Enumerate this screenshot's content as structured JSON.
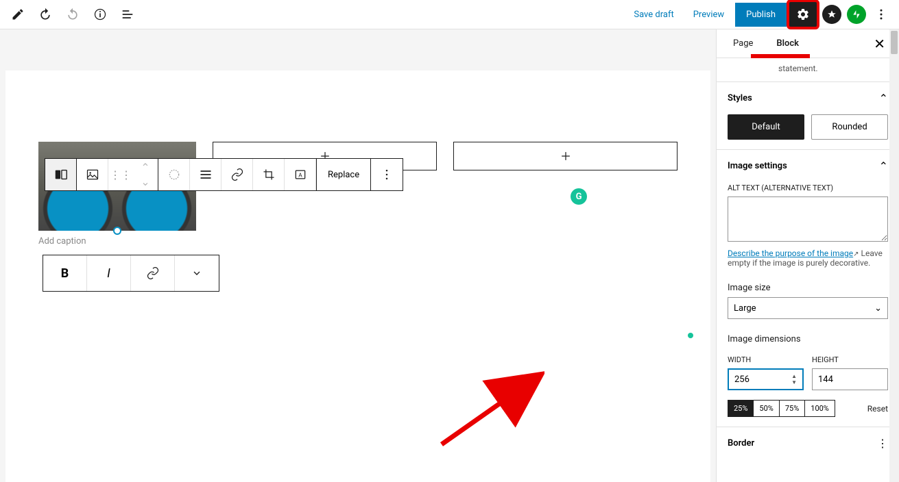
{
  "header": {
    "save_draft": "Save draft",
    "preview": "Preview",
    "publish": "Publish"
  },
  "toolbar": {
    "replace": "Replace"
  },
  "caption_placeholder": "Add caption",
  "sidebar": {
    "tabs": {
      "page": "Page",
      "block": "Block"
    },
    "statement": "statement.",
    "styles": {
      "title": "Styles",
      "default": "Default",
      "rounded": "Rounded"
    },
    "image_settings": {
      "title": "Image settings",
      "alt_label": "ALT TEXT (ALTERNATIVE TEXT)",
      "describe_link": "Describe the purpose of the image",
      "helper": "Leave empty if the image is purely decorative.",
      "size_label": "Image size",
      "size_value": "Large",
      "dimensions_label": "Image dimensions",
      "width_label": "WIDTH",
      "height_label": "HEIGHT",
      "width_value": "256",
      "height_value": "144",
      "presets": [
        "25%",
        "50%",
        "75%",
        "100%"
      ],
      "reset": "Reset"
    },
    "border": {
      "title": "Border"
    }
  }
}
